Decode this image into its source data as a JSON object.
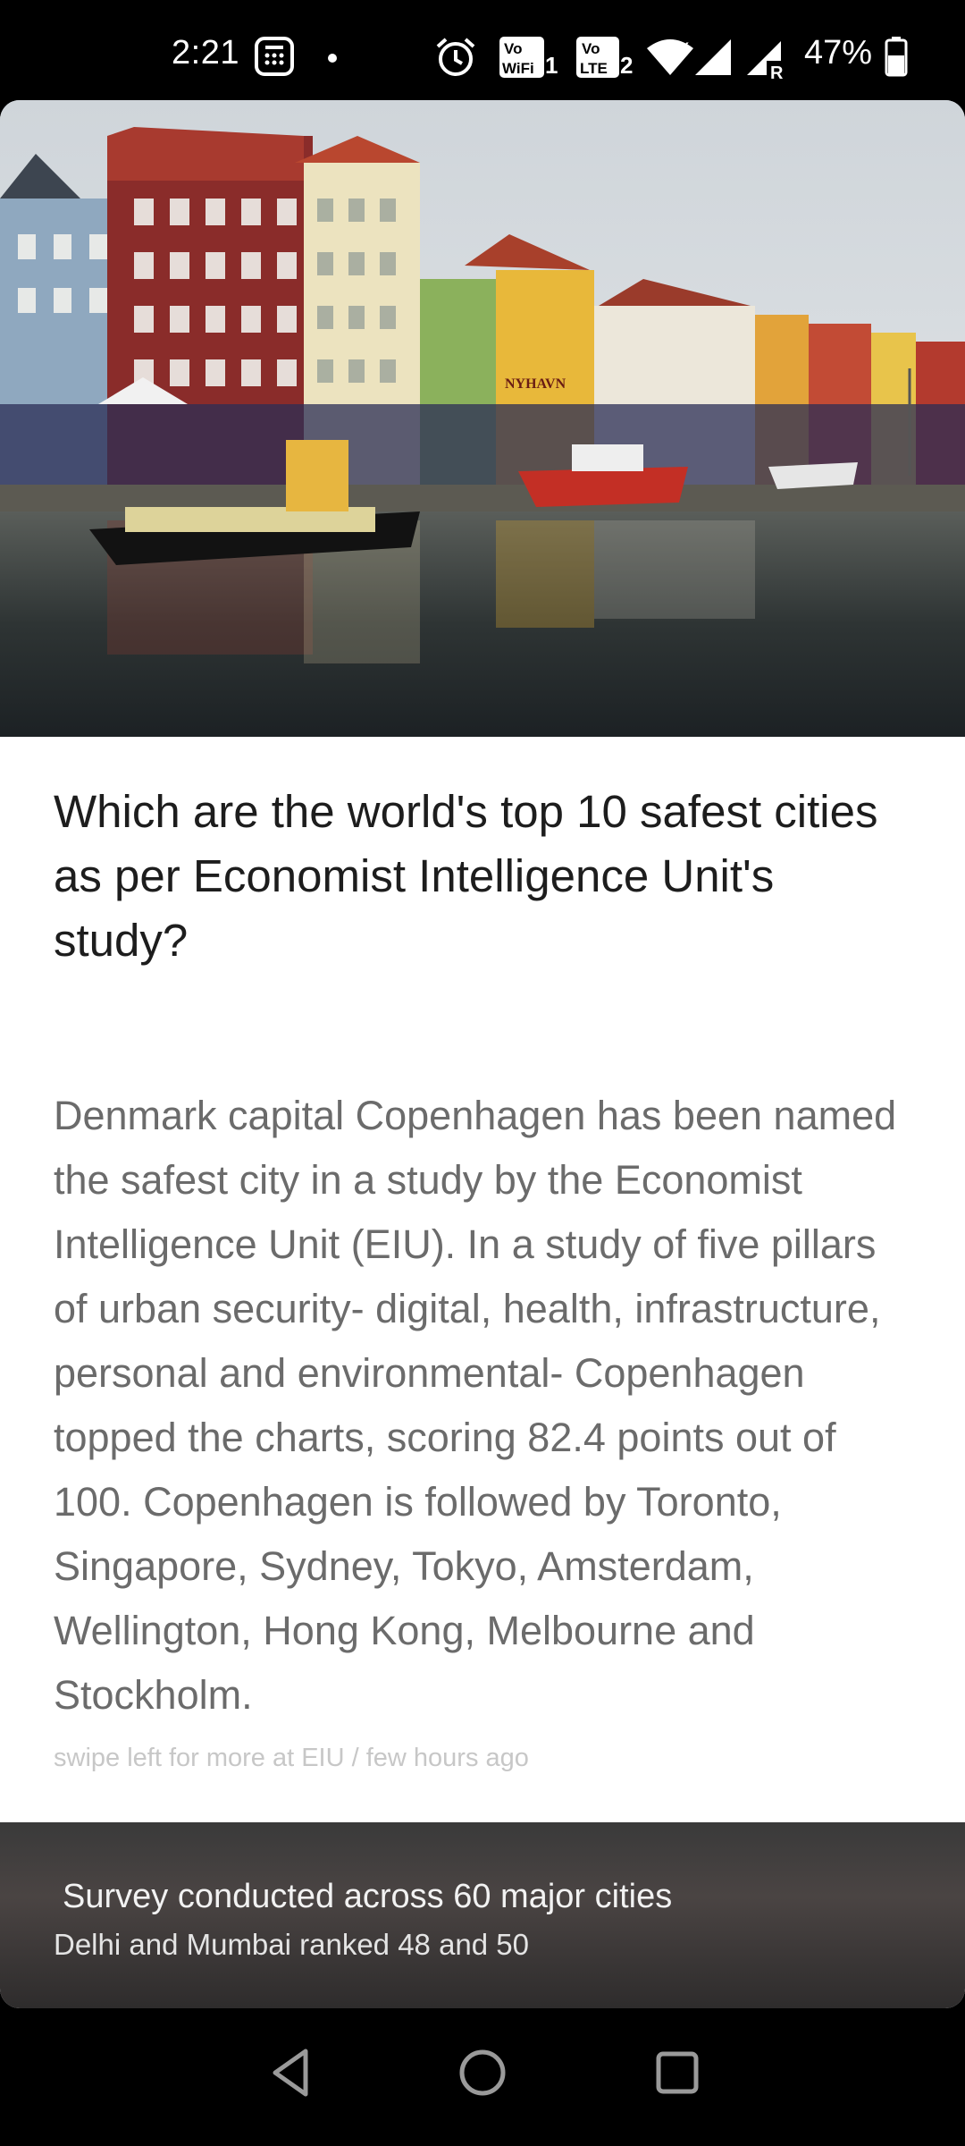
{
  "status_bar": {
    "time": "2:21",
    "battery": "47%",
    "icons": [
      "calculator-notification-icon",
      "dot-icon",
      "alarm-icon",
      "vowifi-icon",
      "volte-icon",
      "wifi-icon",
      "signal-icon",
      "roaming-signal-icon",
      "battery-icon"
    ],
    "vowifi_label": "Vo WiFi",
    "vowifi_sub": "1",
    "volte_label": "Vo LTE",
    "volte_sub": "2"
  },
  "article": {
    "headline": "Which are the world's top 10 safest cities as per Economist Intelligence Unit's study?",
    "body": "Denmark capital Copenhagen has been named the safest city in a study by the Economist Intelligence Unit (EIU). In a study of five pillars of urban security- digital, health, infrastructure, personal and environmental- Copenhagen topped the charts, scoring 82.4 points out of 100. Copenhagen is followed by Toronto, Singapore, Sydney, Tokyo, Amsterdam, Wellington, Hong Kong, Melbourne and Stockholm.",
    "meta": "swipe left for more at EIU / few hours ago",
    "image_sign": "NYHAVN"
  },
  "banner": {
    "title": "Survey conducted across 60 major cities",
    "subtitle": "Delhi and Mumbai ranked 48 and 50"
  },
  "nav": {
    "icons": [
      "back-icon",
      "home-icon",
      "recents-icon"
    ]
  },
  "colors": {
    "headline": "#1d1d1d",
    "body": "#6b6b6b",
    "meta": "#c7c7c7"
  }
}
